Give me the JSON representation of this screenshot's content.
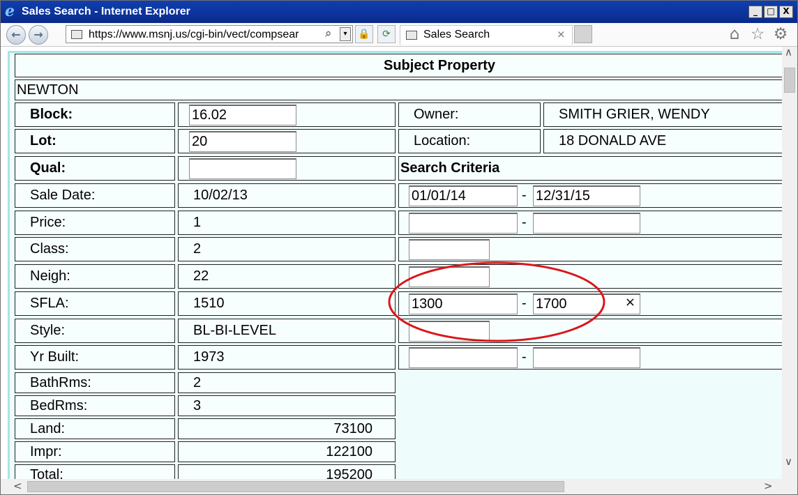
{
  "window": {
    "title": "Sales Search - Internet Explorer",
    "buttons": {
      "minimize": "_",
      "maximize": "□",
      "close": "X"
    }
  },
  "nav": {
    "back": "←",
    "forward": "→",
    "url": "https://www.msnj.us/cgi-bin/vect/compsear",
    "search_glyph": "⌕",
    "dropdown_glyph": "▾",
    "lock_glyph": "🔒",
    "refresh_glyph": "⟳",
    "tab_label": "Sales Search",
    "tab_close": "×",
    "home_glyph": "⌂",
    "favorites_glyph": "☆",
    "tools_glyph": "⚙"
  },
  "page": {
    "header": "Subject Property",
    "municipality": "NEWTON",
    "search_criteria_label": "Search Criteria",
    "left_rows": [
      {
        "label": "Block:",
        "value": "16.02"
      },
      {
        "label": "Lot:",
        "value": "20"
      },
      {
        "label": "Qual:",
        "value": ""
      },
      {
        "label": "Sale Date:",
        "value": "10/02/13"
      },
      {
        "label": "Price:",
        "value": "1"
      },
      {
        "label": "Class:",
        "value": "2"
      },
      {
        "label": "Neigh:",
        "value": "22"
      },
      {
        "label": "SFLA:",
        "value": "1510"
      },
      {
        "label": "Style:",
        "value": "BL-BI-LEVEL"
      },
      {
        "label": "Yr Built:",
        "value": "1973"
      },
      {
        "label": "BathRms:",
        "value": "2"
      },
      {
        "label": "BedRms:",
        "value": "3"
      },
      {
        "label": "Land:",
        "value": "73100"
      },
      {
        "label": "Impr:",
        "value": "122100"
      },
      {
        "label": "Total:",
        "value": "195200"
      }
    ],
    "owner": {
      "label": "Owner:",
      "value": "SMITH GRIER, WENDY"
    },
    "location": {
      "label": "Location:",
      "value": "18 DONALD AVE"
    },
    "criteria": {
      "sale_date_from": "01/01/14",
      "sale_date_to": "12/31/15",
      "price_from": "",
      "price_to": "",
      "class": "",
      "neigh": "",
      "sfla_from": "1300",
      "sfla_to": "1700",
      "sfla_clear": "×",
      "style": "",
      "yr_built_from": "",
      "yr_built_to": ""
    },
    "dash": "-"
  },
  "scroll": {
    "up": "∨",
    "down": "∨",
    "left": "<",
    "right": ">"
  },
  "colors": {
    "highlight_ellipse": "#d9161b",
    "frame_bg": "#eefcfc",
    "title_bar": "#0f3fb0"
  }
}
